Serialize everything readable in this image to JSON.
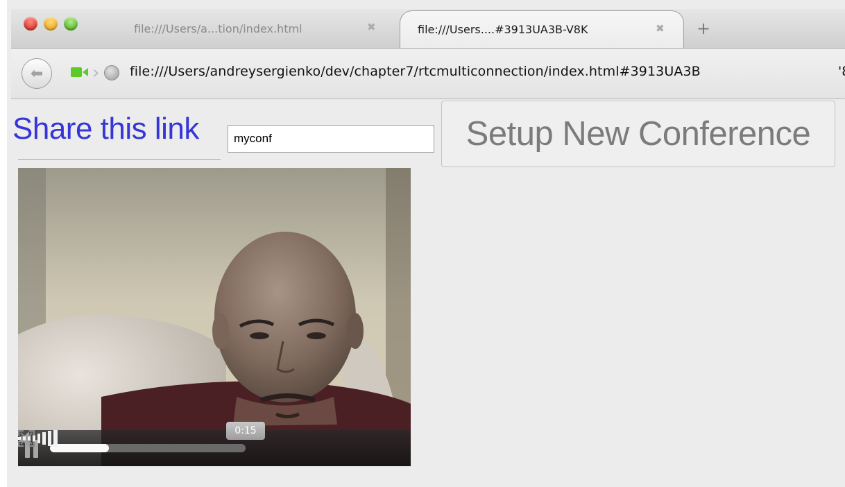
{
  "browser": {
    "tabs": [
      {
        "title": "file:///Users/a...tion/index.html",
        "close_glyph": "✖",
        "active": false
      },
      {
        "title": "file:///Users....#3913UA3B-V8K",
        "close_glyph": "✖",
        "active": true
      }
    ],
    "new_tab_glyph": "+",
    "back_glyph": "⬅",
    "address": "file:///Users/andreysergienko/dev/chapter7/rtcmulticonnection/index.html#3913UA3B",
    "address_overflow": "'8",
    "icons": [
      "traffic-light-close",
      "traffic-light-minimize",
      "traffic-light-zoom",
      "back-arrow-icon",
      "video-camera-icon",
      "globe-icon"
    ]
  },
  "page": {
    "share_title": "Share this link",
    "room_input_value": "myconf",
    "setup_button_label": "Setup New Conference"
  },
  "video": {
    "current_time": "0:15",
    "progress": 0.3,
    "volume_level": 1.0,
    "icons": [
      "pause-icon",
      "speaker-icon",
      "volume-bars-icon",
      "fullscreen-icon"
    ]
  },
  "colors": {
    "share_title": "#3535d8",
    "setup_button_text": "#7b7b7b",
    "camera_icon": "#5ccb2a"
  }
}
